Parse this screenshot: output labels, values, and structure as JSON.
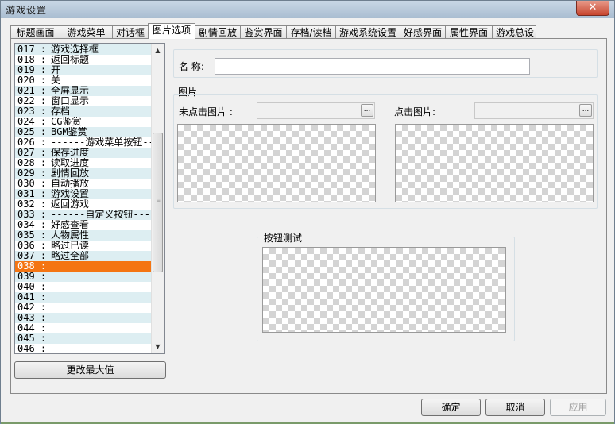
{
  "window": {
    "title": "游戏设置",
    "close_symbol": "✕"
  },
  "tabs": [
    {
      "label": "标题画面"
    },
    {
      "label": "游戏菜单"
    },
    {
      "label": "对话框"
    },
    {
      "label": "图片选项"
    },
    {
      "label": "剧情回放"
    },
    {
      "label": "鉴赏界面"
    },
    {
      "label": "存档/读档"
    },
    {
      "label": "游戏系统设置"
    },
    {
      "label": "好感界面"
    },
    {
      "label": "属性界面"
    },
    {
      "label": "游戏总设"
    }
  ],
  "active_tab": "图片选项",
  "list": {
    "rows": [
      {
        "num": "017 :",
        "text": "游戏选择框"
      },
      {
        "num": "018 :",
        "text": "返回标题"
      },
      {
        "num": "019 :",
        "text": "开"
      },
      {
        "num": "020 :",
        "text": "关"
      },
      {
        "num": "021 :",
        "text": "全屏显示"
      },
      {
        "num": "022 :",
        "text": "窗口显示"
      },
      {
        "num": "023 :",
        "text": "存档"
      },
      {
        "num": "024 :",
        "text": "CG鉴赏"
      },
      {
        "num": "025 :",
        "text": "BGM鉴赏"
      },
      {
        "num": "026 :",
        "text": "------游戏菜单按钮----"
      },
      {
        "num": "027 :",
        "text": "保存进度"
      },
      {
        "num": "028 :",
        "text": "读取进度"
      },
      {
        "num": "029 :",
        "text": "剧情回放"
      },
      {
        "num": "030 :",
        "text": "自动播放"
      },
      {
        "num": "031 :",
        "text": "游戏设置"
      },
      {
        "num": "032 :",
        "text": "返回游戏"
      },
      {
        "num": "033 :",
        "text": "------自定义按钮------"
      },
      {
        "num": "034 :",
        "text": "好感查看"
      },
      {
        "num": "035 :",
        "text": "人物属性"
      },
      {
        "num": "036 :",
        "text": "略过已读"
      },
      {
        "num": "037 :",
        "text": "略过全部"
      },
      {
        "num": "038 :",
        "text": ""
      },
      {
        "num": "039 :",
        "text": ""
      },
      {
        "num": "040 :",
        "text": ""
      },
      {
        "num": "041 :",
        "text": ""
      },
      {
        "num": "042 :",
        "text": ""
      },
      {
        "num": "043 :",
        "text": ""
      },
      {
        "num": "044 :",
        "text": ""
      },
      {
        "num": "045 :",
        "text": ""
      },
      {
        "num": "046 :",
        "text": ""
      }
    ],
    "selected_num": "038 :"
  },
  "change_max_button": "更改最大值",
  "name_label": "名 称:",
  "name_value": "",
  "picture_group": "图片",
  "unclicked_label": "未点击图片 :",
  "clicked_label": "点击图片:",
  "browse_label": "...",
  "button_test_group": "按钮测试",
  "footer": {
    "ok": "确定",
    "cancel": "取消",
    "apply": "应用"
  },
  "colors": {
    "selection": "#f47512",
    "alt_row": "#ddeef2"
  }
}
